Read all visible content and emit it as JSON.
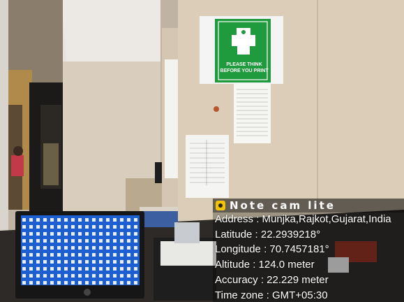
{
  "sign": {
    "text": "PLEASE THINK BEFORE YOU PRINT"
  },
  "overlay": {
    "title": "Note cam lite",
    "address": "Address : Munjka,Rajkot,Gujarat,India",
    "latitude": "Latitude : 22.2939218°",
    "longitude": "Longitude : 70.7457181°",
    "altitude": "Altitude : 124.0 meter",
    "accuracy": "Accuracy : 22.229 meter",
    "timezone": "Time zone : GMT+05:30"
  },
  "colors": {
    "sign_green": "#1f9a3c",
    "logo_yellow": "#f2c300"
  }
}
